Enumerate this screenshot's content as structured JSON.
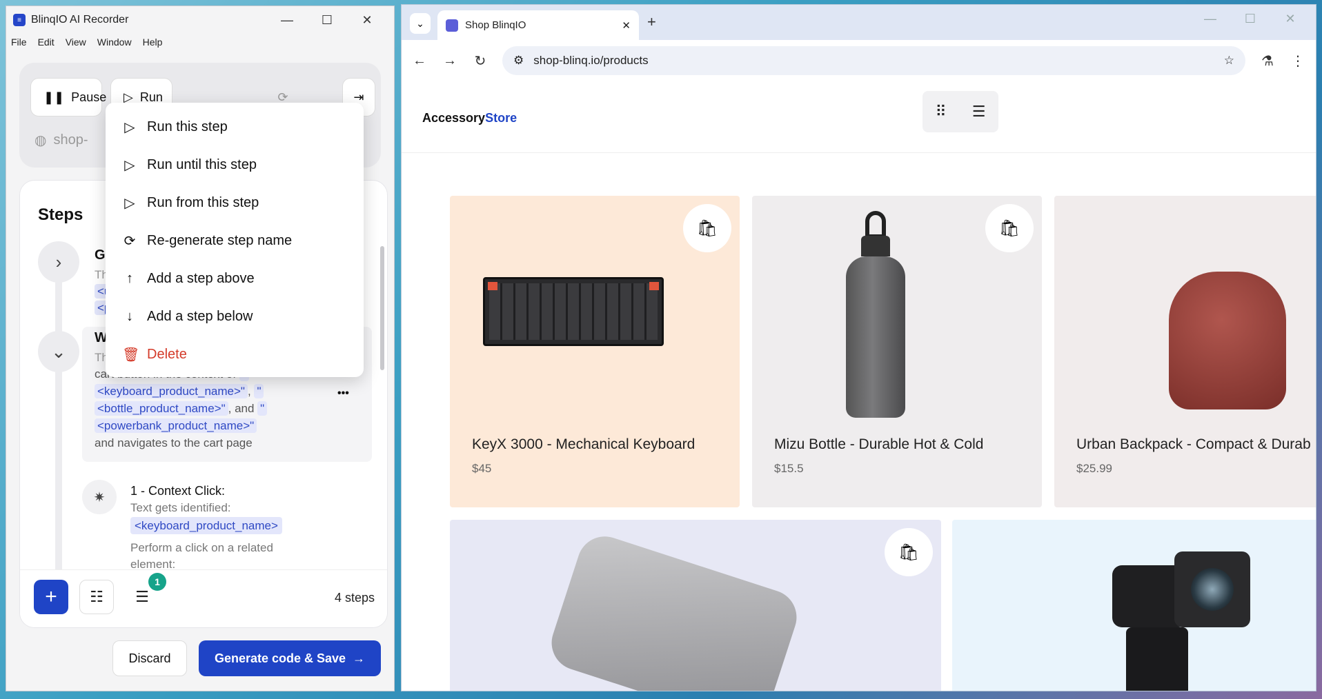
{
  "recorder": {
    "title": "BlinqIO AI Recorder",
    "window_controls": [
      "—",
      "☐",
      "✕"
    ],
    "menu": [
      "File",
      "Edit",
      "View",
      "Window",
      "Help"
    ],
    "toolbar": {
      "pause_label": "Pause",
      "run_label": "Run"
    },
    "url_partial": "shop-",
    "steps_title": "Steps",
    "step1": {
      "letter": "G",
      "line1": "Th",
      "tag1": "<u",
      "tag2": "<p"
    },
    "step2": {
      "letter": "W",
      "line1": "Th",
      "line2": "cart button in the context of",
      "q": "\"",
      "tag_keyboard": "<keyboard_product_name>\"",
      "comma": ",",
      "tag_bottle": "<bottle_product_name>\"",
      "and_text": ", and",
      "tag_powerbank": "<powerbank_product_name>\"",
      "last_line": "and navigates to the cart page",
      "more_icon": "•••"
    },
    "substep": {
      "title": "1 - Context Click:",
      "line1": "Text gets identified:",
      "tag": "<keyboard_product_name>",
      "line2": "Perform a click on a related",
      "line3": "element:"
    },
    "bottom": {
      "steps_count": "4 steps",
      "badge": "1"
    },
    "discard_label": "Discard",
    "generate_label": "Generate code & Save"
  },
  "context_menu": {
    "items": [
      {
        "label": "Run this step",
        "icon": "play-icon"
      },
      {
        "label": "Run until this step",
        "icon": "play-sparkle-icon"
      },
      {
        "label": "Run from this step",
        "icon": "play-from-icon"
      },
      {
        "label": "Re-generate step name",
        "icon": "refresh-icon"
      },
      {
        "label": "Add a step above",
        "icon": "arrow-up-icon"
      },
      {
        "label": "Add a step below",
        "icon": "arrow-down-icon"
      },
      {
        "label": "Delete",
        "icon": "trash-icon"
      }
    ]
  },
  "browser": {
    "tab_title": "Shop BlinqIO",
    "url": "shop-blinq.io/products",
    "store_logo_a": "Accessory",
    "store_logo_b": "Store",
    "products": [
      {
        "name": "KeyX 3000 - Mechanical Keyboard",
        "price": "$45"
      },
      {
        "name": "Mizu Bottle - Durable Hot & Cold",
        "price": "$15.5"
      },
      {
        "name": "Urban Backpack - Compact & Durab",
        "price": "$25.99"
      }
    ]
  },
  "colors": {
    "accent": "#1f44c6",
    "danger": "#d43b2a",
    "tag_bg": "#e3e6fb",
    "badge": "#16a38a"
  }
}
